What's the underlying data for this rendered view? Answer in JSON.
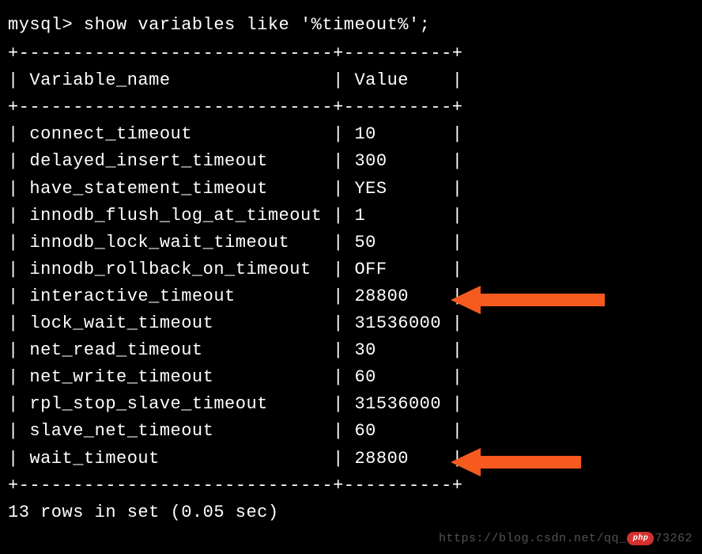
{
  "prompt": "mysql> show variables like '%timeout%';",
  "divider_top": "+-----------------------------+----------+",
  "header": {
    "col1": "Variable_name",
    "col2": "Value"
  },
  "divider_mid": "+-----------------------------+----------+",
  "rows": [
    {
      "name": "connect_timeout",
      "value": "10"
    },
    {
      "name": "delayed_insert_timeout",
      "value": "300"
    },
    {
      "name": "have_statement_timeout",
      "value": "YES"
    },
    {
      "name": "innodb_flush_log_at_timeout",
      "value": "1"
    },
    {
      "name": "innodb_lock_wait_timeout",
      "value": "50"
    },
    {
      "name": "innodb_rollback_on_timeout",
      "value": "OFF"
    },
    {
      "name": "interactive_timeout",
      "value": "28800"
    },
    {
      "name": "lock_wait_timeout",
      "value": "31536000"
    },
    {
      "name": "net_read_timeout",
      "value": "30"
    },
    {
      "name": "net_write_timeout",
      "value": "60"
    },
    {
      "name": "rpl_stop_slave_timeout",
      "value": "31536000"
    },
    {
      "name": "slave_net_timeout",
      "value": "60"
    },
    {
      "name": "wait_timeout",
      "value": "28800"
    }
  ],
  "divider_bottom": "+-----------------------------+----------+",
  "footer": "13 rows in set (0.05 sec)",
  "watermark": {
    "prefix": "https://blog.csdn.net/qq_",
    "suffix": "73262"
  },
  "arrow_color": "#f65a1f"
}
